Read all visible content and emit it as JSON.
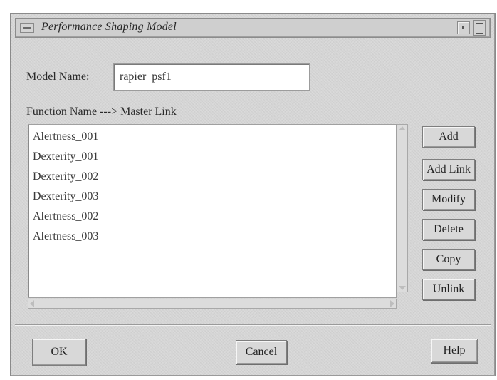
{
  "window": {
    "title": "Performance Shaping Model"
  },
  "form": {
    "model_name_label": "Model Name:",
    "model_name_value": "rapier_psf1",
    "function_header": "Function Name ---> Master Link"
  },
  "list": {
    "items": [
      "Alertness_001",
      "Dexterity_001",
      "Dexterity_002",
      "Dexterity_003",
      "Alertness_002",
      "Alertness_003"
    ]
  },
  "side_buttons": {
    "add": "Add",
    "add_link": "Add Link",
    "modify": "Modify",
    "delete": "Delete",
    "copy": "Copy",
    "unlink": "Unlink"
  },
  "dialog_buttons": {
    "ok": "OK",
    "cancel": "Cancel",
    "help": "Help"
  },
  "icons": {
    "window_menu": "window-menu-icon",
    "minimize": "minimize-icon",
    "maximize": "maximize-icon"
  }
}
